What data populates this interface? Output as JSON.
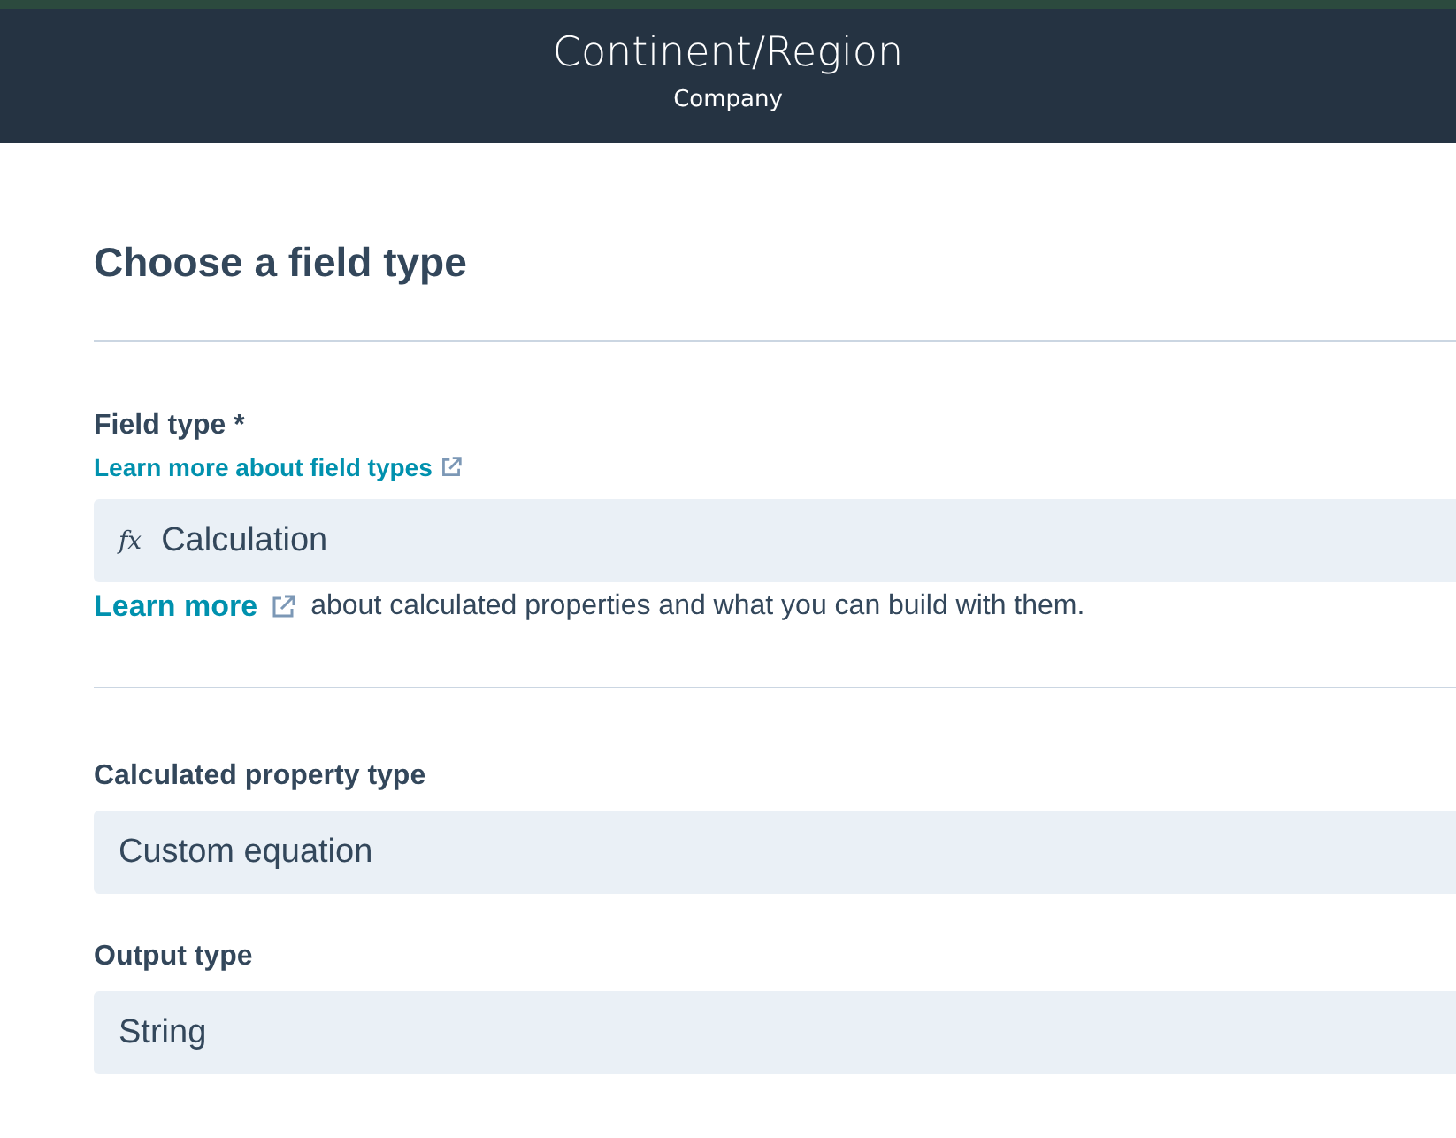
{
  "header": {
    "title": "Continent/Region",
    "subtitle": "Company"
  },
  "heading": "Choose a field type",
  "field_type": {
    "label": "Field type *",
    "help_link": "Learn more about field types",
    "icon": "fx",
    "value": "Calculation",
    "note_link": "Learn more",
    "note": "about calculated properties and what you can build with them."
  },
  "fields": [
    {
      "label": "Calculated property type",
      "value": "Custom equation"
    },
    {
      "label": "Output type",
      "value": "String"
    }
  ]
}
